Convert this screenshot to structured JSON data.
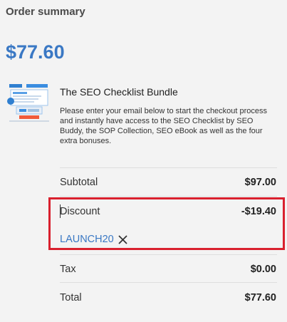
{
  "summary": {
    "title": "Order summary",
    "total_display": "$77.60"
  },
  "product": {
    "name": "The SEO Checklist Bundle",
    "description": "Please enter your email below to start the checkout process and instantly have access to the SEO Checklist by SEO Buddy, the SOP Collection, SEO eBook as well as the four extra bonuses.",
    "thumbnail_icon": "product-bundle-image"
  },
  "lines": {
    "subtotal_label": "Subtotal",
    "subtotal_value": "$97.00",
    "discount_label": "Discount",
    "discount_value": "-$19.40",
    "coupon_code": "LAUNCH20",
    "coupon_remove_icon": "close-icon",
    "tax_label": "Tax",
    "tax_value": "$0.00",
    "total_label": "Total",
    "total_value": "$77.60"
  },
  "colors": {
    "accent": "#3a78c4",
    "highlight": "#d9202e",
    "background": "#f3f3f3"
  }
}
